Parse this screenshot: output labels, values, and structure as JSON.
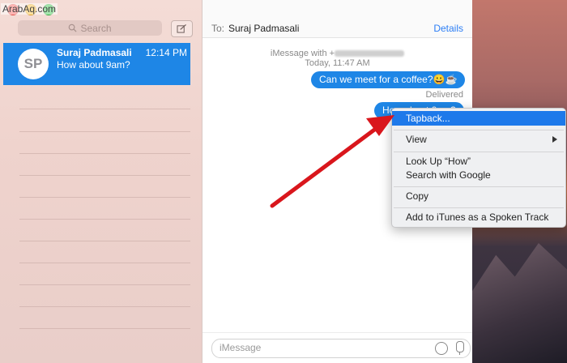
{
  "watermark": "ArabAq.com",
  "sidebar": {
    "search_placeholder": "Search",
    "conversation": {
      "initials": "SP",
      "name": "Suraj Padmasali",
      "time": "12:14 PM",
      "preview": "How about 9am?"
    }
  },
  "chat": {
    "to_label": "To:",
    "recipient": "Suraj Padmasali",
    "details_label": "Details",
    "service_label": "iMessage with +",
    "timestamp": "Today, 11:47 AM",
    "messages": [
      {
        "text": "Can we meet for a coffee?😀☕"
      },
      {
        "text": "How about 9am?"
      }
    ],
    "delivered": "Delivered",
    "input_placeholder": "iMessage"
  },
  "context_menu": {
    "items": [
      {
        "label": "Tapback...",
        "highlighted": true
      },
      {
        "label": "View",
        "submenu": true
      },
      {
        "label": "Look Up “How”"
      },
      {
        "label": "Search with Google"
      },
      {
        "label": "Copy"
      },
      {
        "label": "Add to iTunes as a Spoken Track"
      }
    ]
  },
  "colors": {
    "accent": "#1e86e6",
    "menu_highlight": "#1e79ea",
    "annotation_arrow": "#d9161c"
  }
}
